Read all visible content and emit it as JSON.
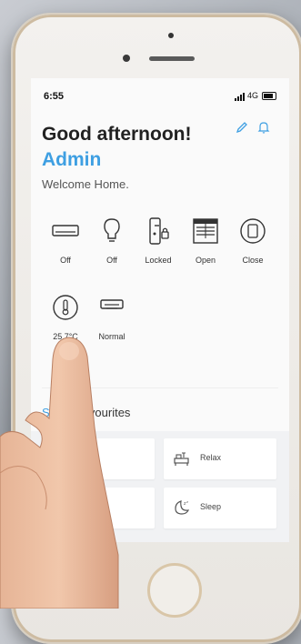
{
  "status": {
    "time": "6:55",
    "network": "4G"
  },
  "header": {
    "greeting": "Good afternoon!",
    "user": "Admin",
    "welcome": "Welcome Home."
  },
  "devices": [
    {
      "icon": "air-conditioner-icon",
      "label": "Off"
    },
    {
      "icon": "light-bulb-icon",
      "label": "Off"
    },
    {
      "icon": "door-lock-icon",
      "label": "Locked"
    },
    {
      "icon": "window-blind-icon",
      "label": "Open"
    },
    {
      "icon": "door-icon",
      "label": "Close"
    },
    {
      "icon": "thermometer-icon",
      "label": "25.7°C"
    },
    {
      "icon": "smoke-detector-icon",
      "label": "Normal"
    }
  ],
  "favourites": {
    "title_a": "S",
    "title_b": "avourites",
    "scenes": [
      {
        "icon": "home-scene-icon",
        "label": "me"
      },
      {
        "icon": "relax-icon",
        "label": "Relax"
      },
      {
        "icon": "scene-icon",
        "label": ""
      },
      {
        "icon": "sleep-icon",
        "label": "Sleep"
      }
    ]
  },
  "colors": {
    "accent": "#3e9fe2",
    "text": "#222222"
  }
}
